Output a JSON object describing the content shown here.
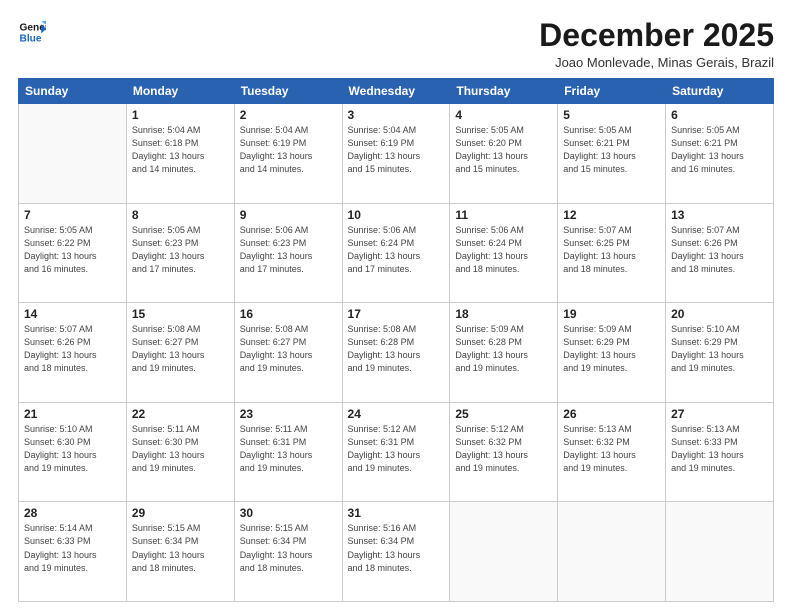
{
  "header": {
    "logo_line1": "General",
    "logo_line2": "Blue",
    "month_title": "December 2025",
    "location": "Joao Monlevade, Minas Gerais, Brazil"
  },
  "days_of_week": [
    "Sunday",
    "Monday",
    "Tuesday",
    "Wednesday",
    "Thursday",
    "Friday",
    "Saturday"
  ],
  "weeks": [
    [
      {
        "num": "",
        "info": ""
      },
      {
        "num": "1",
        "info": "Sunrise: 5:04 AM\nSunset: 6:18 PM\nDaylight: 13 hours\nand 14 minutes."
      },
      {
        "num": "2",
        "info": "Sunrise: 5:04 AM\nSunset: 6:19 PM\nDaylight: 13 hours\nand 14 minutes."
      },
      {
        "num": "3",
        "info": "Sunrise: 5:04 AM\nSunset: 6:19 PM\nDaylight: 13 hours\nand 15 minutes."
      },
      {
        "num": "4",
        "info": "Sunrise: 5:05 AM\nSunset: 6:20 PM\nDaylight: 13 hours\nand 15 minutes."
      },
      {
        "num": "5",
        "info": "Sunrise: 5:05 AM\nSunset: 6:21 PM\nDaylight: 13 hours\nand 15 minutes."
      },
      {
        "num": "6",
        "info": "Sunrise: 5:05 AM\nSunset: 6:21 PM\nDaylight: 13 hours\nand 16 minutes."
      }
    ],
    [
      {
        "num": "7",
        "info": "Sunrise: 5:05 AM\nSunset: 6:22 PM\nDaylight: 13 hours\nand 16 minutes."
      },
      {
        "num": "8",
        "info": "Sunrise: 5:05 AM\nSunset: 6:23 PM\nDaylight: 13 hours\nand 17 minutes."
      },
      {
        "num": "9",
        "info": "Sunrise: 5:06 AM\nSunset: 6:23 PM\nDaylight: 13 hours\nand 17 minutes."
      },
      {
        "num": "10",
        "info": "Sunrise: 5:06 AM\nSunset: 6:24 PM\nDaylight: 13 hours\nand 17 minutes."
      },
      {
        "num": "11",
        "info": "Sunrise: 5:06 AM\nSunset: 6:24 PM\nDaylight: 13 hours\nand 18 minutes."
      },
      {
        "num": "12",
        "info": "Sunrise: 5:07 AM\nSunset: 6:25 PM\nDaylight: 13 hours\nand 18 minutes."
      },
      {
        "num": "13",
        "info": "Sunrise: 5:07 AM\nSunset: 6:26 PM\nDaylight: 13 hours\nand 18 minutes."
      }
    ],
    [
      {
        "num": "14",
        "info": "Sunrise: 5:07 AM\nSunset: 6:26 PM\nDaylight: 13 hours\nand 18 minutes."
      },
      {
        "num": "15",
        "info": "Sunrise: 5:08 AM\nSunset: 6:27 PM\nDaylight: 13 hours\nand 19 minutes."
      },
      {
        "num": "16",
        "info": "Sunrise: 5:08 AM\nSunset: 6:27 PM\nDaylight: 13 hours\nand 19 minutes."
      },
      {
        "num": "17",
        "info": "Sunrise: 5:08 AM\nSunset: 6:28 PM\nDaylight: 13 hours\nand 19 minutes."
      },
      {
        "num": "18",
        "info": "Sunrise: 5:09 AM\nSunset: 6:28 PM\nDaylight: 13 hours\nand 19 minutes."
      },
      {
        "num": "19",
        "info": "Sunrise: 5:09 AM\nSunset: 6:29 PM\nDaylight: 13 hours\nand 19 minutes."
      },
      {
        "num": "20",
        "info": "Sunrise: 5:10 AM\nSunset: 6:29 PM\nDaylight: 13 hours\nand 19 minutes."
      }
    ],
    [
      {
        "num": "21",
        "info": "Sunrise: 5:10 AM\nSunset: 6:30 PM\nDaylight: 13 hours\nand 19 minutes."
      },
      {
        "num": "22",
        "info": "Sunrise: 5:11 AM\nSunset: 6:30 PM\nDaylight: 13 hours\nand 19 minutes."
      },
      {
        "num": "23",
        "info": "Sunrise: 5:11 AM\nSunset: 6:31 PM\nDaylight: 13 hours\nand 19 minutes."
      },
      {
        "num": "24",
        "info": "Sunrise: 5:12 AM\nSunset: 6:31 PM\nDaylight: 13 hours\nand 19 minutes."
      },
      {
        "num": "25",
        "info": "Sunrise: 5:12 AM\nSunset: 6:32 PM\nDaylight: 13 hours\nand 19 minutes."
      },
      {
        "num": "26",
        "info": "Sunrise: 5:13 AM\nSunset: 6:32 PM\nDaylight: 13 hours\nand 19 minutes."
      },
      {
        "num": "27",
        "info": "Sunrise: 5:13 AM\nSunset: 6:33 PM\nDaylight: 13 hours\nand 19 minutes."
      }
    ],
    [
      {
        "num": "28",
        "info": "Sunrise: 5:14 AM\nSunset: 6:33 PM\nDaylight: 13 hours\nand 19 minutes."
      },
      {
        "num": "29",
        "info": "Sunrise: 5:15 AM\nSunset: 6:34 PM\nDaylight: 13 hours\nand 18 minutes."
      },
      {
        "num": "30",
        "info": "Sunrise: 5:15 AM\nSunset: 6:34 PM\nDaylight: 13 hours\nand 18 minutes."
      },
      {
        "num": "31",
        "info": "Sunrise: 5:16 AM\nSunset: 6:34 PM\nDaylight: 13 hours\nand 18 minutes."
      },
      {
        "num": "",
        "info": ""
      },
      {
        "num": "",
        "info": ""
      },
      {
        "num": "",
        "info": ""
      }
    ]
  ]
}
